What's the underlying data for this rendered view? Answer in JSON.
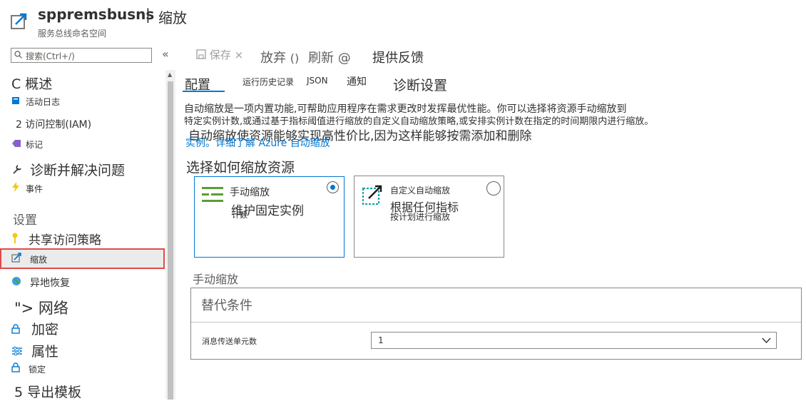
{
  "header": {
    "resource_name": "sppremsbusns",
    "separator": "|",
    "page_title": "缩放",
    "resource_type": "服务总线命名空间"
  },
  "search": {
    "placeholder": "搜索(Ctrl+/)"
  },
  "sidebar": {
    "collapse": "«",
    "items": [
      {
        "label": "C 概述"
      },
      {
        "label": "活动日志"
      },
      {
        "label": "2 访问控制(IAM)"
      },
      {
        "label": "标记"
      },
      {
        "label": "诊断并解决问题"
      },
      {
        "label": "事件"
      }
    ],
    "section_settings": "设置",
    "settings_items": [
      {
        "label": "共享访问策略"
      },
      {
        "label": "缩放"
      },
      {
        "label": "异地恢复"
      },
      {
        "label": "\">  网络"
      },
      {
        "label": "加密"
      },
      {
        "label": "属性"
      },
      {
        "label": "锁定"
      },
      {
        "label": "5 导出模板"
      }
    ]
  },
  "toolbar": {
    "save": "保存",
    "discard": "放弃",
    "refresh": "刷新",
    "feedback": "提供反馈"
  },
  "tabs": [
    {
      "label": "配置"
    },
    {
      "label": "运行历史记录"
    },
    {
      "label": "JSON"
    },
    {
      "label": "通知"
    },
    {
      "label": "诊断设置"
    }
  ],
  "description": {
    "line1": "自动缩放是一项内置功能,可帮助应用程序在需求更改时发挥最优性能。你可以选择将资源手动缩放到",
    "line2": "特定实例计数,或通过基于指标阈值进行缩放的自定义自动缩放策略,或安排实例计数在指定的时间期限内进行缩放。",
    "line3": "自动缩放使资源能够实现高性价比,因为这样能够按需添加和删除",
    "link": "实例。详细了解 Azure 自动缩放"
  },
  "choose_title": "选择如何缩放资源",
  "cards": {
    "manual": {
      "title": "手动缩放",
      "desc": "维护固定实例",
      "desc2": "计数",
      "selected": true
    },
    "custom": {
      "title": "自定义自动缩放",
      "desc": "根据任何指标",
      "desc2": "按计划进行缩放",
      "selected": false
    }
  },
  "manual_section": {
    "title": "手动缩放",
    "override": "替代条件",
    "field_label": "消息传送单元数",
    "field_value": "1"
  },
  "colors": {
    "accent": "#0078d4",
    "highlight_border": "#e04a4a",
    "icon_green": "#5a9e32",
    "icon_teal": "#1ba1a5"
  }
}
